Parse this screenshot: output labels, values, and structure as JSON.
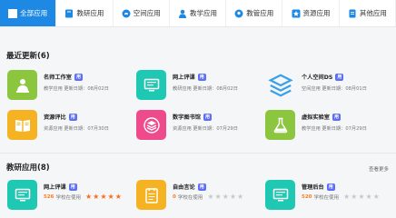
{
  "tabs": [
    {
      "label": "全部应用",
      "icon": "grid-icon",
      "active": true
    },
    {
      "label": "教研应用",
      "icon": "book-icon",
      "active": false
    },
    {
      "label": "空间应用",
      "icon": "cloud-icon",
      "active": false
    },
    {
      "label": "教学应用",
      "icon": "teacher-icon",
      "active": false
    },
    {
      "label": "教管应用",
      "icon": "head-icon",
      "active": false
    },
    {
      "label": "资源应用",
      "icon": "star-icon",
      "active": false
    },
    {
      "label": "其他应用",
      "icon": "file-icon",
      "active": false
    }
  ],
  "recent": {
    "title": "最近更新(6)",
    "items": [
      {
        "name": "名师工作室",
        "tag": "用",
        "date": "教学应用  更新日期：08月02日",
        "color": "#8cc63f",
        "icon": "person-podium-icon"
      },
      {
        "name": "网上评课",
        "tag": "用",
        "date": "教研应用  更新日期：08月02日",
        "color": "#1fc8b3",
        "icon": "monitor-icon"
      },
      {
        "name": "个人空间DS",
        "tag": "用",
        "date": "空间应用  更新日期：08月01日",
        "color": "#ffffff",
        "icon": "layers-icon"
      },
      {
        "name": "资源评比",
        "tag": "用",
        "date": "资源应用  更新日期：07月30日",
        "color": "#f5b324",
        "icon": "open-book-icon"
      },
      {
        "name": "数字图书馆",
        "tag": "用",
        "date": "资源应用  更新日期：07月29日",
        "color": "#ee4a8c",
        "icon": "stack-icon"
      },
      {
        "name": "虚拟实验室",
        "tag": "用",
        "date": "教学应用  更新日期：07月29日",
        "color": "#8cc63f",
        "icon": "flask-icon"
      }
    ]
  },
  "research": {
    "title": "教研应用(8)",
    "more": "查看更多",
    "items": [
      {
        "name": "网上评课",
        "tag": "用",
        "count": "526",
        "suffix": "学校在使用",
        "stars": 5,
        "color": "#1fc8b3",
        "icon": "monitor-icon"
      },
      {
        "name": "自由言论",
        "tag": "用",
        "count": "0",
        "suffix": "学校在使用",
        "stars": 0,
        "color": "#f5b324",
        "icon": "notepad-icon"
      },
      {
        "name": "管理后台",
        "tag": "用",
        "count": "520",
        "suffix": "学校在使用",
        "stars": 0,
        "color": "#1fc8b3",
        "icon": "monitor-icon"
      }
    ]
  }
}
